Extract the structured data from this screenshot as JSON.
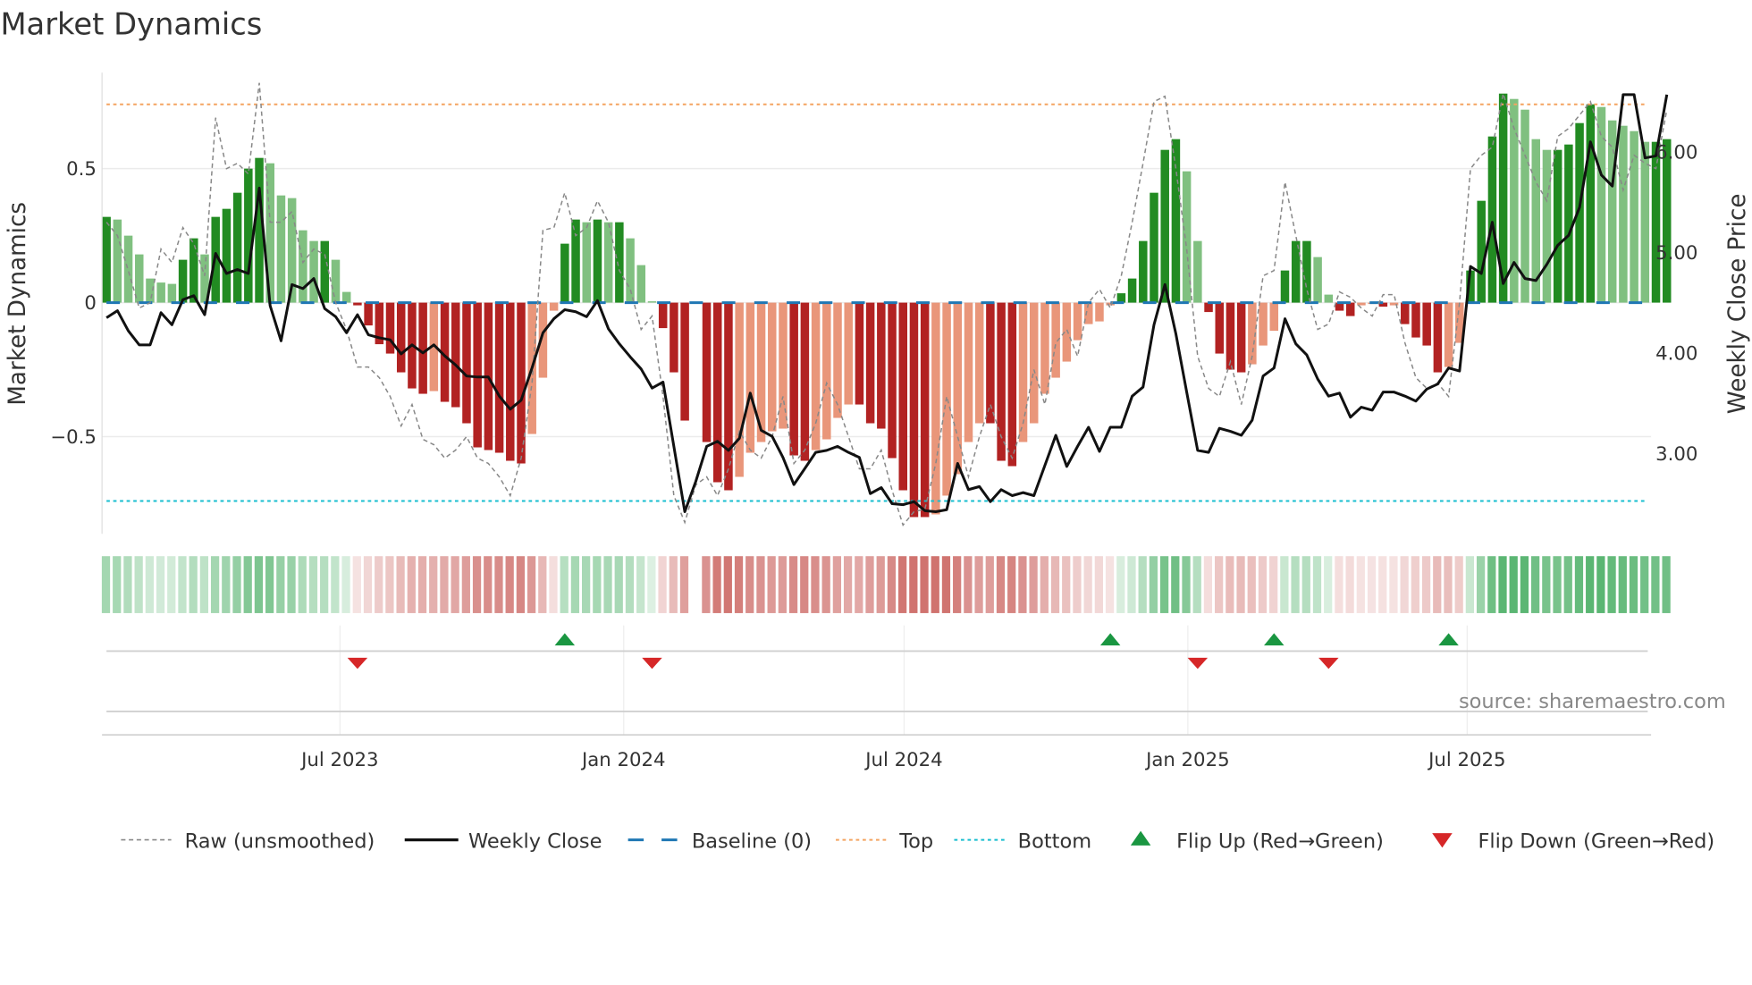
{
  "title": "Market Dynamics",
  "source": "source: sharemaestro.com",
  "colors": {
    "green_strong": "#228b22",
    "green_weak": "#80c080",
    "red_strong": "#b22222",
    "red_weak": "#e9967a",
    "top": "#f4a460",
    "bottom": "#17becf",
    "baseline": "#1f77b4",
    "raw": "#888888",
    "close": "#111111",
    "flip_up": "#1a9641",
    "flip_down": "#d62728"
  },
  "chart_data": {
    "type": "bar",
    "title": "Market Dynamics",
    "ylabel": "Market Dynamics",
    "y2label": "Weekly Close Price",
    "ylim": [
      -0.87,
      0.86
    ],
    "y2lim": [
      2.3,
      6.9
    ],
    "yticks": [
      {
        "v": 0.5,
        "label": "0.5"
      },
      {
        "v": 0,
        "label": "0"
      },
      {
        "v": -0.5,
        "label": "−0.5"
      }
    ],
    "y2ticks": [
      {
        "v": 6,
        "label": "6.00"
      },
      {
        "v": 5,
        "label": "5.00"
      },
      {
        "v": 4,
        "label": "4.00"
      },
      {
        "v": 3,
        "label": "3.00"
      }
    ],
    "xticks": [
      {
        "week": 21.4,
        "label": "Jul 2023"
      },
      {
        "week": 47.4,
        "label": "Jan 2024"
      },
      {
        "week": 73.1,
        "label": "Jul 2024"
      },
      {
        "week": 99.1,
        "label": "Jan 2025"
      },
      {
        "week": 124.7,
        "label": "Jul 2025"
      }
    ],
    "top_level": 0.74,
    "bottom_level": -0.74,
    "baseline": 0,
    "grid": true,
    "legend_placement": "bottom",
    "values": [
      0.32,
      0.31,
      0.25,
      0.18,
      0.09,
      0.075,
      0.07,
      0.16,
      0.24,
      0.18,
      0.32,
      0.35,
      0.41,
      0.5,
      0.54,
      0.52,
      0.4,
      0.39,
      0.27,
      0.23,
      0.23,
      0.16,
      0.04,
      -0.01,
      -0.085,
      -0.155,
      -0.19,
      -0.26,
      -0.32,
      -0.34,
      -0.33,
      -0.37,
      -0.39,
      -0.45,
      -0.54,
      -0.55,
      -0.56,
      -0.59,
      -0.6,
      -0.49,
      -0.28,
      -0.03,
      0.22,
      0.31,
      0.3,
      0.31,
      0.3,
      0.3,
      0.24,
      0.14,
      0.005,
      -0.095,
      -0.26,
      -0.44,
      null,
      -0.52,
      -0.67,
      -0.7,
      -0.65,
      -0.56,
      -0.52,
      -0.48,
      -0.47,
      -0.57,
      -0.59,
      -0.55,
      -0.51,
      -0.43,
      -0.38,
      -0.38,
      -0.45,
      -0.47,
      -0.58,
      -0.7,
      -0.8,
      -0.8,
      -0.79,
      -0.72,
      -0.64,
      -0.52,
      -0.45,
      -0.45,
      -0.59,
      -0.61,
      -0.52,
      -0.45,
      -0.34,
      -0.28,
      -0.22,
      -0.14,
      -0.08,
      -0.07,
      -0.01,
      0.035,
      0.09,
      0.23,
      0.41,
      0.57,
      0.61,
      0.49,
      0.23,
      -0.035,
      -0.19,
      -0.25,
      -0.26,
      -0.23,
      -0.16,
      -0.105,
      0.12,
      0.23,
      0.23,
      0.17,
      0.03,
      -0.03,
      -0.05,
      -0.01,
      -0.005,
      -0.015,
      -0.01,
      -0.08,
      -0.13,
      -0.16,
      -0.26,
      -0.24,
      -0.15,
      0.12,
      0.38,
      0.62,
      0.78,
      0.76,
      0.72,
      0.61,
      0.57,
      0.57,
      0.59,
      0.67,
      0.74,
      0.73,
      0.68,
      0.66,
      0.64,
      0.6,
      0.6,
      0.61
    ],
    "raw": [
      0.3,
      0.25,
      0.12,
      -0.02,
      0.0,
      0.2,
      0.15,
      0.28,
      0.22,
      0.1,
      0.69,
      0.5,
      0.52,
      0.48,
      0.82,
      0.3,
      0.3,
      0.34,
      0.15,
      0.2,
      0.18,
      0,
      -0.1,
      -0.24,
      -0.24,
      -0.28,
      -0.35,
      -0.46,
      -0.38,
      -0.51,
      -0.53,
      -0.58,
      -0.55,
      -0.5,
      -0.58,
      -0.6,
      -0.65,
      -0.72,
      -0.58,
      -0.3,
      0.27,
      0.28,
      0.41,
      0.25,
      0.28,
      0.38,
      0.3,
      0.12,
      0.05,
      -0.1,
      -0.05,
      -0.35,
      -0.72,
      -0.82,
      -0.68,
      -0.65,
      -0.72,
      -0.62,
      -0.48,
      -0.55,
      -0.58,
      -0.5,
      -0.35,
      -0.6,
      -0.55,
      -0.45,
      -0.3,
      -0.38,
      -0.5,
      -0.62,
      -0.62,
      -0.55,
      -0.7,
      -0.83,
      -0.78,
      -0.77,
      -0.6,
      -0.35,
      -0.5,
      -0.65,
      -0.5,
      -0.38,
      -0.5,
      -0.58,
      -0.45,
      -0.25,
      -0.38,
      -0.15,
      -0.1,
      -0.2,
      0.0,
      0.05,
      -0.02,
      0.1,
      0.3,
      0.52,
      0.75,
      0.77,
      0.5,
      0.2,
      -0.2,
      -0.32,
      -0.35,
      -0.22,
      -0.38,
      -0.2,
      0.1,
      0.12,
      0.45,
      0.25,
      0.05,
      -0.1,
      -0.08,
      0.04,
      0.02,
      -0.02,
      -0.05,
      0.03,
      0.03,
      -0.15,
      -0.28,
      -0.32,
      -0.3,
      -0.35,
      0.0,
      0.5,
      0.55,
      0.58,
      0.78,
      0.65,
      0.55,
      0.45,
      0.38,
      0.62,
      0.65,
      0.7,
      0.75,
      0.62,
      0.58,
      0.42,
      0.55,
      0.52,
      0.5,
      0.72
    ],
    "weekly_close": [
      4.35,
      4.42,
      4.22,
      4.08,
      4.08,
      4.4,
      4.28,
      4.53,
      4.57,
      4.38,
      4.99,
      4.79,
      4.83,
      4.79,
      5.64,
      4.47,
      4.12,
      4.68,
      4.64,
      4.74,
      4.44,
      4.36,
      4.2,
      4.38,
      4.18,
      4.15,
      4.13,
      3.99,
      4.08,
      4.0,
      4.08,
      3.97,
      3.88,
      3.77,
      3.76,
      3.76,
      3.57,
      3.44,
      3.53,
      3.85,
      4.2,
      4.34,
      4.43,
      4.41,
      4.36,
      4.52,
      4.24,
      4.09,
      3.96,
      3.84,
      3.65,
      3.71,
      3.07,
      2.42,
      2.72,
      3.07,
      3.12,
      3.03,
      3.15,
      3.6,
      3.23,
      3.17,
      2.96,
      2.69,
      2.85,
      3.01,
      3.03,
      3.07,
      3.01,
      2.96,
      2.6,
      2.66,
      2.5,
      2.49,
      2.52,
      2.43,
      2.42,
      2.44,
      2.9,
      2.64,
      2.67,
      2.52,
      2.64,
      2.58,
      2.61,
      2.58,
      2.88,
      3.18,
      2.87,
      3.07,
      3.26,
      3.02,
      3.26,
      3.26,
      3.57,
      3.66,
      4.28,
      4.68,
      4.19,
      3.61,
      3.03,
      3.01,
      3.25,
      3.22,
      3.18,
      3.33,
      3.77,
      3.85,
      4.34,
      4.09,
      3.98,
      3.74,
      3.57,
      3.6,
      3.36,
      3.46,
      3.43,
      3.61,
      3.61,
      3.57,
      3.52,
      3.64,
      3.69,
      3.85,
      3.82,
      4.86,
      4.79,
      5.3,
      4.69,
      4.9,
      4.74,
      4.72,
      4.88,
      5.07,
      5.17,
      5.45,
      6.1,
      5.77,
      5.66,
      6.57,
      6.57,
      5.94,
      5.96,
      6.57
    ],
    "flip_up_weeks": [
      42,
      92,
      107,
      123
    ],
    "flip_down_weeks": [
      23,
      50,
      100,
      112
    ],
    "legend": [
      {
        "key": "raw",
        "label": "Raw (unsmoothed)"
      },
      {
        "key": "close",
        "label": "Weekly Close"
      },
      {
        "key": "baseline",
        "label": "Baseline (0)"
      },
      {
        "key": "top",
        "label": "Top"
      },
      {
        "key": "bottom",
        "label": "Bottom"
      },
      {
        "key": "flip_up",
        "label": "Flip Up (Red→Green)"
      },
      {
        "key": "flip_down",
        "label": "Flip Down (Green→Red)"
      }
    ]
  }
}
